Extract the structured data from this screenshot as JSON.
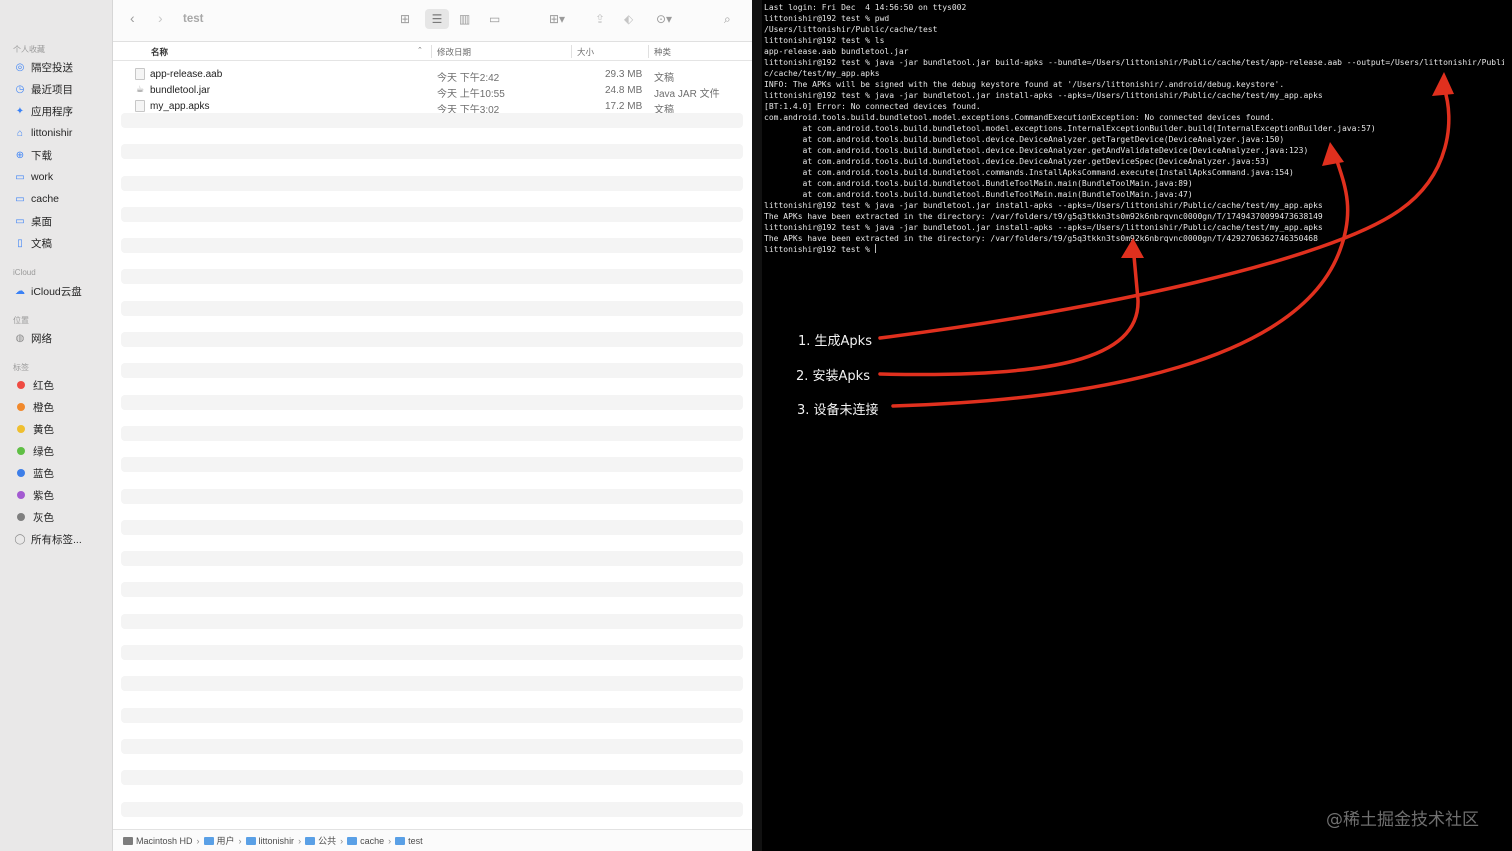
{
  "finder": {
    "title": "test",
    "sidebar": {
      "favorites_header": "个人收藏",
      "favorites": [
        {
          "label": "隔空投送",
          "icon": "airdrop-icon"
        },
        {
          "label": "最近项目",
          "icon": "clock-icon"
        },
        {
          "label": "应用程序",
          "icon": "applications-icon"
        },
        {
          "label": "littonishir",
          "icon": "home-icon"
        },
        {
          "label": "下载",
          "icon": "download-icon"
        },
        {
          "label": "work",
          "icon": "folder-icon"
        },
        {
          "label": "cache",
          "icon": "folder-icon"
        },
        {
          "label": "桌面",
          "icon": "desktop-icon"
        },
        {
          "label": "文稿",
          "icon": "document-icon"
        }
      ],
      "icloud_header": "iCloud",
      "icloud": [
        {
          "label": "iCloud云盘",
          "icon": "cloud-icon"
        }
      ],
      "locations_header": "位置",
      "locations": [
        {
          "label": "网络",
          "icon": "network-icon"
        }
      ],
      "tags_header": "标签",
      "tags": [
        {
          "label": "红色",
          "color": "#ef4b43"
        },
        {
          "label": "橙色",
          "color": "#f1892c"
        },
        {
          "label": "黄色",
          "color": "#efbf2f"
        },
        {
          "label": "绿色",
          "color": "#5fbf45"
        },
        {
          "label": "蓝色",
          "color": "#3d7ee8"
        },
        {
          "label": "紫色",
          "color": "#a35ad1"
        },
        {
          "label": "灰色",
          "color": "#7f7f7f"
        }
      ],
      "all_tags": "所有标签..."
    },
    "columns": {
      "name": "名称",
      "modified": "修改日期",
      "size": "大小",
      "kind": "种类"
    },
    "files": [
      {
        "name": "app-release.aab",
        "modified": "今天 下午2:42",
        "size": "29.3 MB",
        "kind": "文稿"
      },
      {
        "name": "bundletool.jar",
        "modified": "今天 上午10:55",
        "size": "24.8 MB",
        "kind": "Java JAR 文件"
      },
      {
        "name": "my_app.apks",
        "modified": "今天 下午3:02",
        "size": "17.2 MB",
        "kind": "文稿"
      }
    ],
    "path": [
      "Macintosh HD",
      "用户",
      "littonishir",
      "公共",
      "cache",
      "test"
    ]
  },
  "terminal": {
    "lines": [
      "Last login: Fri Dec  4 14:56:50 on ttys002",
      "littonishir@192 test % pwd",
      "/Users/littonishir/Public/cache/test",
      "littonishir@192 test % ls",
      "app-release.aab bundletool.jar",
      "littonishir@192 test % java -jar bundletool.jar build-apks --bundle=/Users/littonishir/Public/cache/test/app-release.aab --output=/Users/littonishir/Publi",
      "c/cache/test/my_app.apks",
      "INFO: The APKs will be signed with the debug keystore found at '/Users/littonishir/.android/debug.keystore'.",
      "littonishir@192 test % java -jar bundletool.jar install-apks --apks=/Users/littonishir/Public/cache/test/my_app.apks",
      "[BT:1.4.0] Error: No connected devices found.",
      "com.android.tools.build.bundletool.model.exceptions.CommandExecutionException: No connected devices found.",
      "        at com.android.tools.build.bundletool.model.exceptions.InternalExceptionBuilder.build(InternalExceptionBuilder.java:57)",
      "        at com.android.tools.build.bundletool.device.DeviceAnalyzer.getTargetDevice(DeviceAnalyzer.java:150)",
      "        at com.android.tools.build.bundletool.device.DeviceAnalyzer.getAndValidateDevice(DeviceAnalyzer.java:123)",
      "        at com.android.tools.build.bundletool.device.DeviceAnalyzer.getDeviceSpec(DeviceAnalyzer.java:53)",
      "        at com.android.tools.build.bundletool.commands.InstallApksCommand.execute(InstallApksCommand.java:154)",
      "        at com.android.tools.build.bundletool.BundleToolMain.main(BundleToolMain.java:89)",
      "        at com.android.tools.build.bundletool.BundleToolMain.main(BundleToolMain.java:47)",
      "littonishir@192 test % java -jar bundletool.jar install-apks --apks=/Users/littonishir/Public/cache/test/my_app.apks",
      "The APKs have been extracted in the directory: /var/folders/t9/g5q3tkkn3ts0m92k6nbrqvnc0000gn/T/17494370099473638149",
      "littonishir@192 test % java -jar bundletool.jar install-apks --apks=/Users/littonishir/Public/cache/test/my_app.apks",
      "The APKs have been extracted in the directory: /var/folders/t9/g5q3tkkn3ts0m92k6nbrqvnc0000gn/T/4292706362746350468",
      "littonishir@192 test % "
    ]
  },
  "annotations": [
    {
      "label": "1.  生成Apks"
    },
    {
      "label": "2.  安装Apks"
    },
    {
      "label": "3.  设备未连接"
    }
  ],
  "arrow_color": "#e0301e",
  "watermark": "@稀土掘金技术社区"
}
